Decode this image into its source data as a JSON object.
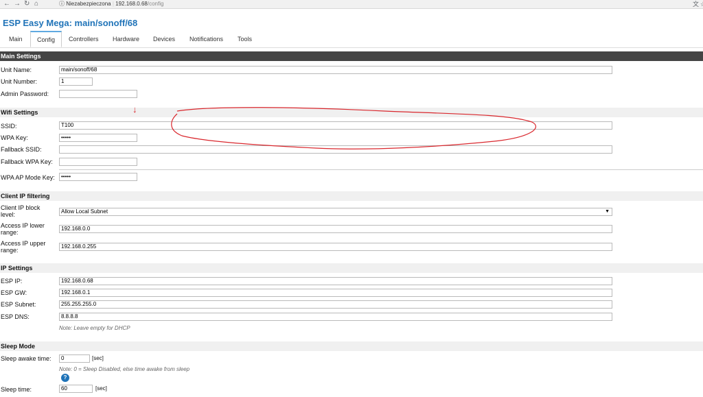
{
  "browser": {
    "security": "Niezabezpieczona",
    "host": "192.168.0.68",
    "path": "/config",
    "icons": [
      "back-icon",
      "forward-icon",
      "reload-icon",
      "home-icon",
      "info-icon",
      "translate-icon",
      "star-icon"
    ]
  },
  "app": {
    "title": "ESP Easy Mega: main/sonoff/68"
  },
  "tabs": [
    "Main",
    "Config",
    "Controllers",
    "Hardware",
    "Devices",
    "Notifications",
    "Tools"
  ],
  "active_tab": "Config",
  "main_settings": {
    "header": "Main Settings",
    "unit_name_label": "Unit Name:",
    "unit_name": "main/sonoff/68",
    "unit_number_label": "Unit Number:",
    "unit_number": "1",
    "admin_password_label": "Admin Password:",
    "admin_password": ""
  },
  "wifi": {
    "header": "Wifi Settings",
    "ssid_label": "SSID:",
    "ssid": "T100",
    "wpa_key_label": "WPA Key:",
    "wpa_key": "•••••",
    "fallback_ssid_label": "Fallback SSID:",
    "fallback_ssid": "",
    "fallback_wpa_label": "Fallback WPA Key:",
    "fallback_wpa": "",
    "ap_key_label": "WPA AP Mode Key:",
    "ap_key": "•••••"
  },
  "client_ip": {
    "header": "Client IP filtering",
    "block_label": "Client IP block level:",
    "block_value": "Allow Local Subnet",
    "lower_label": "Access IP lower range:",
    "lower": "192.168.0.0",
    "upper_label": "Access IP upper range:",
    "upper": "192.168.0.255"
  },
  "ip": {
    "header": "IP Settings",
    "ip_label": "ESP IP:",
    "ip_value": "192.168.0.68",
    "gw_label": "ESP GW:",
    "gw_value": "192.168.0.1",
    "subnet_label": "ESP Subnet:",
    "subnet_value": "255.255.255.0",
    "dns_label": "ESP DNS:",
    "dns_value": "8.8.8.8",
    "note": "Note: Leave empty for DHCP"
  },
  "sleep": {
    "header": "Sleep Mode",
    "awake_label": "Sleep awake time:",
    "awake_value": "0",
    "awake_unit": "[sec]",
    "note": "Note: 0 = Sleep Disabled, else time awake from sleep",
    "help": "?",
    "sleep_label": "Sleep time:",
    "sleep_value": "60",
    "sleep_unit": "[sec]"
  },
  "annotation": {
    "arrow": "↓",
    "color": "#d9262c"
  }
}
